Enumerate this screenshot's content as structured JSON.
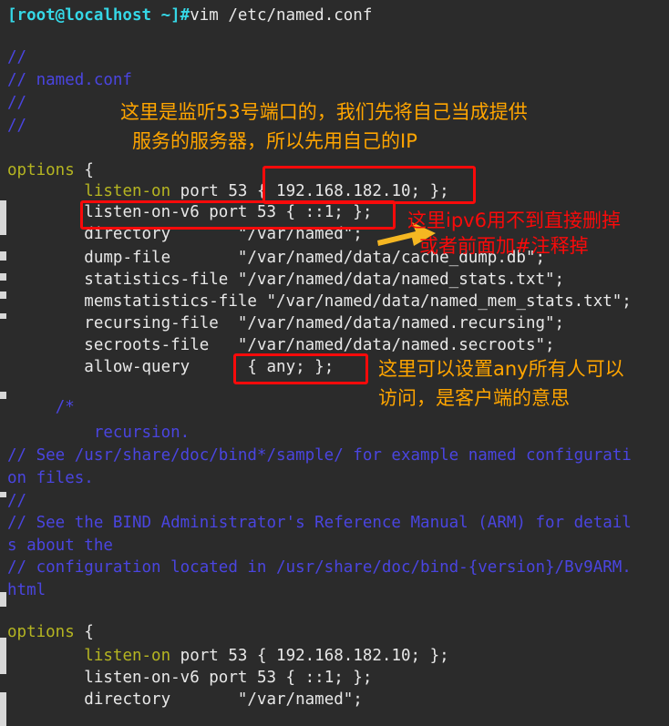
{
  "terminal": {
    "prompt": "[root@localhost ~]#",
    "command": "vim /etc/named.conf",
    "lines": [
      {
        "id": "c1",
        "text": "//"
      },
      {
        "id": "c2",
        "text": "// named.conf"
      },
      {
        "id": "c3",
        "text": "//"
      },
      {
        "id": "c4",
        "text": "//"
      },
      {
        "id": "opt1_open_kw",
        "text": "options"
      },
      {
        "id": "opt1_open_br",
        "text": "{"
      },
      {
        "id": "l_listen_kw",
        "text": "listen-on"
      },
      {
        "id": "l_listen_rest",
        "text": "port 53 { 192.168.182.10; };"
      },
      {
        "id": "l_listen6",
        "text": "listen-on-v6 port 53 { ::1; };"
      },
      {
        "id": "l_directory",
        "text": "directory       \"/var/named\";"
      },
      {
        "id": "l_dumpfile",
        "text": "dump-file       \"/var/named/data/cache_dump.db\";"
      },
      {
        "id": "l_statsfile",
        "text": "statistics-file \"/var/named/data/named_stats.txt\";"
      },
      {
        "id": "l_memstats",
        "text": "memstatistics-file \"/var/named/data/named_mem_stats.txt\";"
      },
      {
        "id": "l_recursing",
        "text": "recursing-file  \"/var/named/data/named.recursing\";"
      },
      {
        "id": "l_secroots",
        "text": "secroots-file   \"/var/named/data/named.secroots\";"
      },
      {
        "id": "l_allowquery",
        "text": "allow-query"
      },
      {
        "id": "l_allowval",
        "text": "{ any; };"
      },
      {
        "id": "l_blockopen",
        "text": "/*"
      },
      {
        "id": "l_recursion",
        "text": "recursion."
      },
      {
        "id": "l_see1a",
        "text": "// See /usr/share/doc/bind*/sample/ for example named configurati"
      },
      {
        "id": "l_see1b",
        "text": "on files."
      },
      {
        "id": "l_c5",
        "text": "//"
      },
      {
        "id": "l_see2a",
        "text": "// See the BIND Administrator's Reference Manual (ARM) for detail"
      },
      {
        "id": "l_see2b",
        "text": "s about the"
      },
      {
        "id": "l_see3a",
        "text": "// configuration located in /usr/share/doc/bind-{version}/Bv9ARM."
      },
      {
        "id": "l_see3b",
        "text": "html"
      },
      {
        "id": "opt2_open_kw",
        "text": "options"
      },
      {
        "id": "opt2_open_br",
        "text": "{"
      },
      {
        "id": "b_listen_kw",
        "text": "listen-on"
      },
      {
        "id": "b_listen_rest",
        "text": "port 53 { 192.168.182.10; };"
      },
      {
        "id": "b_listen6",
        "text": "listen-on-v6 port 53 { ::1; };"
      },
      {
        "id": "b_directory",
        "text": "directory       \"/var/named\";"
      }
    ]
  },
  "annotations": {
    "note_listen_line1": "这里是监听53号端口的，我们先将自己当成提供",
    "note_listen_line2": "服务的服务器，所以先用自己的IP",
    "note_ipv6_line1": "这里ipv6用不到直接删掉",
    "note_ipv6_line2": "或者前面加#注释掉",
    "note_anyquery_line1": "这里可以设置any所有人可以",
    "note_anyquery_line2": "访问，是客户端的意思"
  },
  "colors": {
    "background": "#2b2b2b",
    "prompt": "#35d7e6",
    "text": "#e8e8e8",
    "comment": "#4a45e0",
    "keyword": "#b5b521",
    "highlight_box": "#fa0a0a",
    "note_orange": "#ffa500",
    "note_red": "#fa0a0a",
    "arrow": "#f5b722"
  }
}
